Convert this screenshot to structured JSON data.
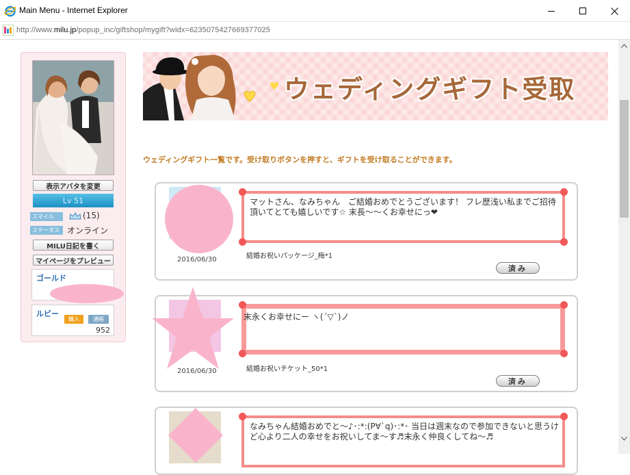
{
  "window": {
    "title": "Main Menu - Internet Explorer",
    "url_prefix": "http://www.",
    "url_domain": "milu.jp",
    "url_path": "/popup_inc/giftshop/mygift?widx=6235075427669377025"
  },
  "sidebar": {
    "change_avatar_label": "表示アバタを変更",
    "level_label": "Lv 51",
    "smile_tag": "スマイル",
    "smile_count": "(15)",
    "status_tag": "ステータス",
    "status_value": "オンライン",
    "diary_button_label": "MILU日記を書く",
    "preview_button_label": "マイページをプレビュー",
    "gold_label": "ゴールド",
    "ruby_label": "ルビー",
    "ruby_buy_label": "購入",
    "ruby_history_label": "通帳",
    "ruby_amount": "952"
  },
  "banner": {
    "title": "ウェディングギフト受取"
  },
  "intro_text": "ウェディングギフト一覧です。受け取りボタンを押すと、ギフトを受け取ることができます。",
  "gifts": [
    {
      "message": "マットさん、なみちゃん　ご結婚おめでとうございます！ フレ歴浅い私までご招待頂いてとても嬉しいです☆ 末長～～くお幸せにっ❤",
      "date": "2016/06/30",
      "item": "結婚お祝いパッケージ_梅*1",
      "button_label": "済み"
    },
    {
      "message": "末永くお幸せにー ヽ(´▽`)ノ",
      "date": "2016/06/30",
      "item": "結婚お祝いチケット_50*1",
      "button_label": "済み"
    },
    {
      "message": "なみちゃん結婚おめでと～♪･:*:(P∀`q)･:*･ 当日は週末なので参加できないと思うけど心より二人の幸せをお祝いしてま～す♬末永く仲良くしてね～♬",
      "date": "",
      "item": "",
      "button_label": ""
    }
  ],
  "colors": {
    "accent_orange": "#c27a22",
    "banner_text": "#a7683a",
    "frame_pink": "#f48c8c",
    "level_blue": "#1d8fc2"
  }
}
